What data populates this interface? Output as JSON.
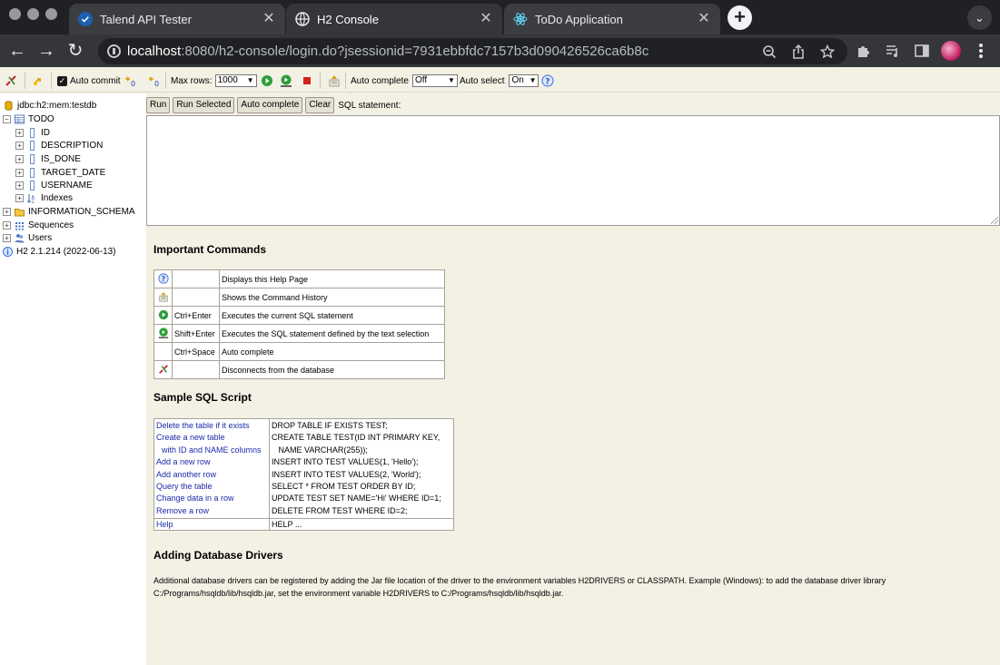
{
  "browser": {
    "tabs": [
      {
        "title": "Talend API Tester",
        "icon": "talend-check-icon"
      },
      {
        "title": "H2 Console",
        "icon": "globe-icon"
      },
      {
        "title": "ToDo Application",
        "icon": "react-atom-icon"
      }
    ],
    "new_tab_label": "+",
    "url_host": "localhost",
    "url_path": ":8080/h2-console/login.do?jsessionid=7931ebbfdc7157b3d090426526ca6b8c"
  },
  "toolbar": {
    "auto_commit_label": "Auto commit",
    "max_rows_label": "Max rows:",
    "max_rows_value": "1000",
    "auto_complete_label": "Auto complete",
    "auto_complete_value": "Off",
    "auto_select_label": "Auto select",
    "auto_select_value": "On"
  },
  "tree": {
    "connection": "jdbc:h2:mem:testdb",
    "table": "TODO",
    "columns": [
      "ID",
      "DESCRIPTION",
      "IS_DONE",
      "TARGET_DATE",
      "USERNAME"
    ],
    "indexes": "Indexes",
    "schema": "INFORMATION_SCHEMA",
    "sequences": "Sequences",
    "users": "Users",
    "version": "H2 2.1.214 (2022-06-13)"
  },
  "query": {
    "run": "Run",
    "run_selected": "Run Selected",
    "auto_complete": "Auto complete",
    "clear": "Clear",
    "sql_label": "SQL statement:"
  },
  "help": {
    "important_title": "Important Commands",
    "commands": [
      {
        "icon": "help-icon",
        "key": "",
        "desc": "Displays this Help Page"
      },
      {
        "icon": "history-icon",
        "key": "",
        "desc": "Shows the Command History"
      },
      {
        "icon": "run-icon",
        "key": "Ctrl+Enter",
        "desc": "Executes the current SQL statement"
      },
      {
        "icon": "run-selected-icon",
        "key": "Shift+Enter",
        "desc": "Executes the SQL statement defined by the text selection"
      },
      {
        "icon": "",
        "key": "Ctrl+Space",
        "desc": "Auto complete"
      },
      {
        "icon": "disconnect-icon",
        "key": "",
        "desc": "Disconnects from the database"
      }
    ],
    "sample_title": "Sample SQL Script",
    "sample_links": [
      "Delete the table if it exists",
      "Create a new table",
      "with ID and NAME columns",
      "Add a new row",
      "Add another row",
      "Query the table",
      "Change data in a row",
      "Remove a row"
    ],
    "sample_sql": [
      "DROP TABLE IF EXISTS TEST;",
      "CREATE TABLE TEST(ID INT PRIMARY KEY,",
      "   NAME VARCHAR(255));",
      "INSERT INTO TEST VALUES(1, 'Hello');",
      "INSERT INTO TEST VALUES(2, 'World');",
      "SELECT * FROM TEST ORDER BY ID;",
      "UPDATE TEST SET NAME='Hi' WHERE ID=1;",
      "DELETE FROM TEST WHERE ID=2;"
    ],
    "help_link": "Help",
    "help_sql": "HELP ...",
    "drivers_title": "Adding Database Drivers",
    "drivers_text_1": "Additional database drivers can be registered by adding the Jar file location of the driver to the environment variables H2DRIVERS or CLASSPATH. Example (Windows): to add the database driver library",
    "drivers_text_2": "C:/Programs/hsqldb/lib/hsqldb.jar, set the environment variable H2DRIVERS to C:/Programs/hsqldb/lib/hsqldb.jar."
  }
}
